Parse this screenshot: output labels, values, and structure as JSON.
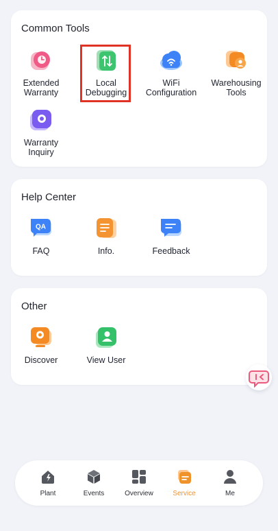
{
  "common_tools": {
    "title": "Common Tools",
    "items": [
      {
        "label": "Extended\nWarranty",
        "icon": "warranty-clock-icon"
      },
      {
        "label": "Local\nDebugging",
        "icon": "debug-arrows-icon"
      },
      {
        "label": "WiFi\nConfiguration",
        "icon": "wifi-cloud-icon"
      },
      {
        "label": "Warehousing\nTools",
        "icon": "warehouse-person-icon"
      },
      {
        "label": "Warranty\nInquiry",
        "icon": "warranty-inquiry-icon"
      }
    ]
  },
  "help_center": {
    "title": "Help Center",
    "items": [
      {
        "label": "FAQ",
        "icon": "qa-bubble-icon",
        "badge": "QA"
      },
      {
        "label": "Info.",
        "icon": "info-document-icon"
      },
      {
        "label": "Feedback",
        "icon": "feedback-bubble-icon"
      }
    ]
  },
  "other": {
    "title": "Other",
    "items": [
      {
        "label": "Discover",
        "icon": "discover-monitor-icon"
      },
      {
        "label": "View User",
        "icon": "view-user-icon"
      }
    ]
  },
  "floating_button": {
    "icon": "chat-support-icon"
  },
  "tabbar": {
    "items": [
      {
        "label": "Plant",
        "icon": "plant-house-icon"
      },
      {
        "label": "Events",
        "icon": "events-cube-icon"
      },
      {
        "label": "Overview",
        "icon": "overview-grid-icon"
      },
      {
        "label": "Service",
        "icon": "service-layers-icon",
        "active": true
      },
      {
        "label": "Me",
        "icon": "me-person-icon"
      }
    ],
    "active_color": "#f0922a"
  }
}
